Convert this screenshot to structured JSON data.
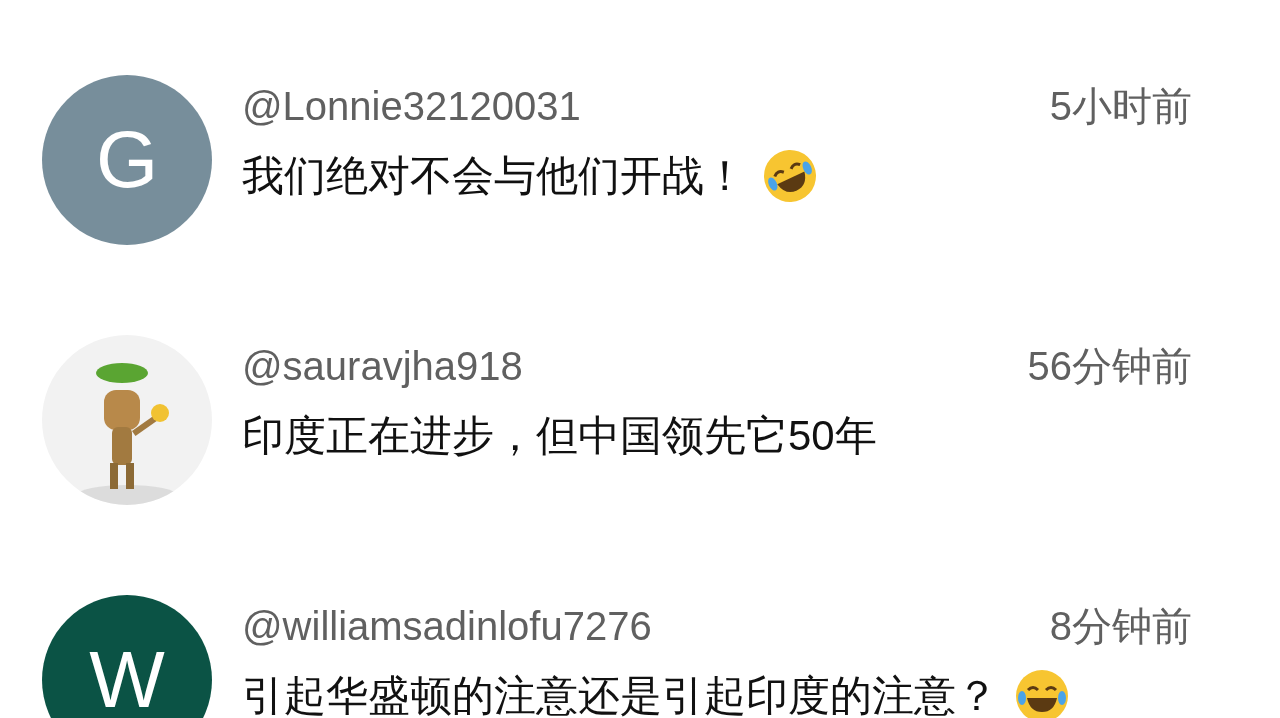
{
  "comments": [
    {
      "avatar": {
        "kind": "letter",
        "letter": "G",
        "color": "#778e9b"
      },
      "user": "@Lonnie32120031",
      "time": "5小时前",
      "text": "我们绝对不会与他们开战！",
      "emoji": {
        "kind": "tilted"
      }
    },
    {
      "user": "@sauravjha918",
      "time": "56分钟前",
      "text": "印度正在进步，但中国领先它50年"
    },
    {
      "avatar": {
        "kind": "letter",
        "letter": "W",
        "color": "#0b5345"
      },
      "user": "@williamsadinlofu7276",
      "time": "8分钟前",
      "text": "引起华盛顿的注意还是引起印度的注意？",
      "emoji": {
        "kind": "upright"
      }
    }
  ]
}
